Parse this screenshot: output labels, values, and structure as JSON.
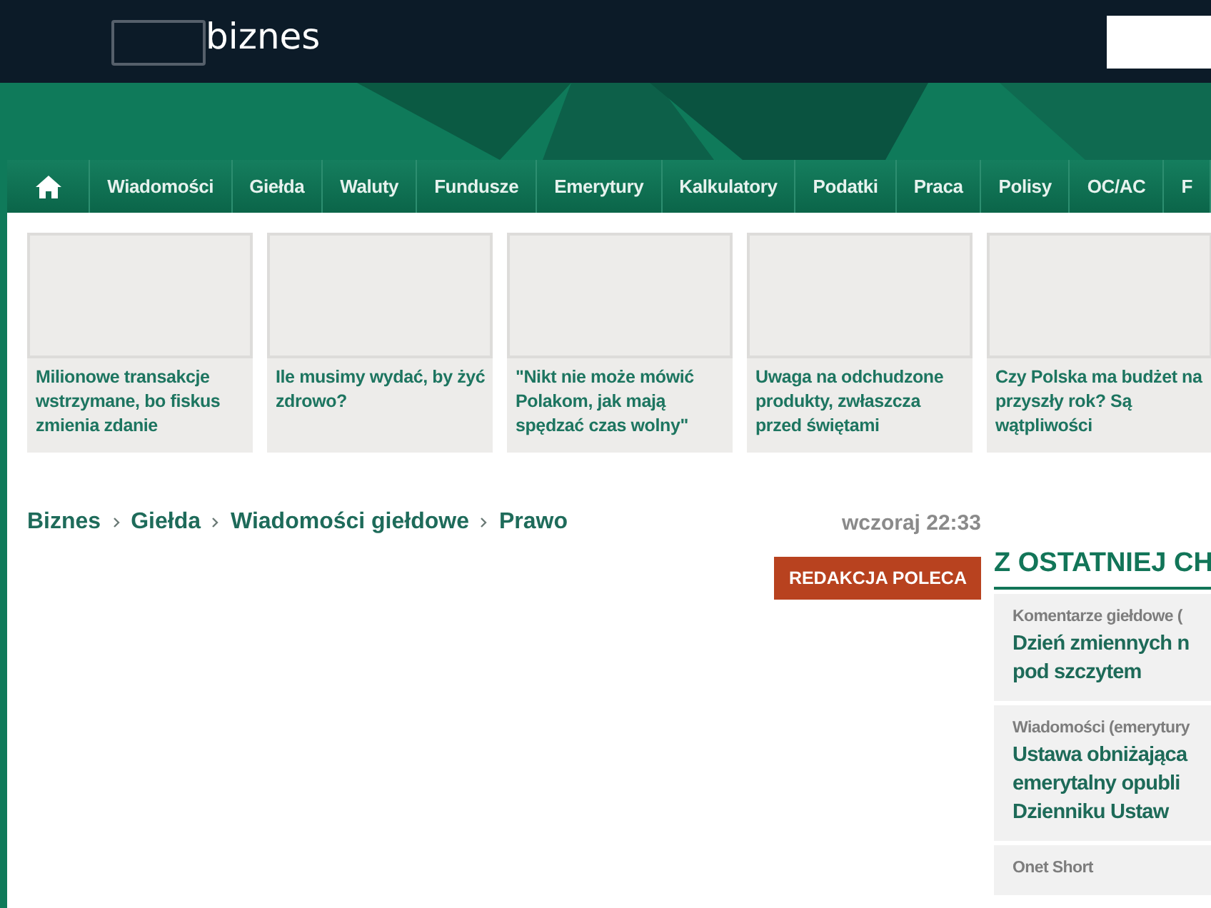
{
  "header": {
    "logo_text": "biznes"
  },
  "nav": {
    "items": [
      {
        "label": "Wiadomości"
      },
      {
        "label": "Giełda"
      },
      {
        "label": "Waluty"
      },
      {
        "label": "Fundusze"
      },
      {
        "label": "Emerytury"
      },
      {
        "label": "Kalkulatory"
      },
      {
        "label": "Podatki"
      },
      {
        "label": "Praca"
      },
      {
        "label": "Polisy"
      },
      {
        "label": "OC/AC"
      },
      {
        "label": "F"
      }
    ]
  },
  "cards": [
    {
      "title": "Milionowe transakcje wstrzymane, bo fiskus zmienia zdanie"
    },
    {
      "title": "Ile musimy wydać, by żyć zdrowo?"
    },
    {
      "title": "\"Nikt nie może mówić Polakom, jak mają spędzać czas wolny\""
    },
    {
      "title": "Uwaga na odchudzone produkty, zwłaszcza przed świętami"
    },
    {
      "title": "Czy Polska ma budżet na przyszły rok? Są wątpliwości"
    }
  ],
  "breadcrumbs": [
    "Biznes",
    "Giełda",
    "Wiadomości giełdowe",
    "Prawo"
  ],
  "date": "wczoraj 22:33",
  "badge": "REDAKCJA POLECA",
  "sidebar": {
    "heading": "Z OSTATNIEJ CH",
    "items": [
      {
        "category": "Komentarze giełdowe (",
        "lines": [
          "Dzień zmiennych n",
          "pod szczytem"
        ]
      },
      {
        "category": "Wiadomości (emerytury",
        "lines": [
          "Ustawa obniżająca",
          "emerytalny opubli",
          "Dzienniku Ustaw"
        ]
      },
      {
        "category": "Onet Short"
      }
    ]
  }
}
